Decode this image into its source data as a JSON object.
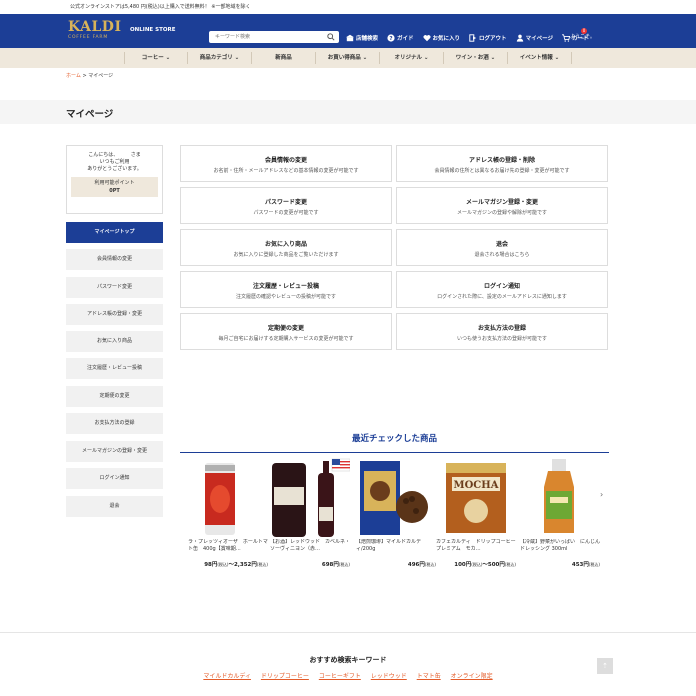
{
  "topbar": {
    "notice": "公式オンラインストアは5,480 円(税込)以上購入で送料無料！ ※一部地域を除く"
  },
  "header": {
    "logo_main": "KALDI",
    "logo_sub": "COFFEE FARM",
    "store_label": "ONLINE STORE",
    "search_placeholder": "キーワード検索",
    "welcome": "ようこそ。",
    "nav": [
      {
        "label": "店舗検索",
        "icon": "store-icon"
      },
      {
        "label": "ガイド",
        "icon": "help-icon"
      },
      {
        "label": "お気に入り",
        "icon": "heart-icon"
      },
      {
        "label": "ログアウト",
        "icon": "logout-icon"
      },
      {
        "label": "マイページ",
        "icon": "user-icon"
      },
      {
        "label": "カート",
        "icon": "cart-icon"
      }
    ],
    "cart_count": "0"
  },
  "catnav": [
    "コーヒー",
    "商品カテゴリ",
    "新商品",
    "お買い得商品",
    "オリジナル",
    "ワイン・お酒",
    "イベント情報"
  ],
  "breadcrumb": {
    "home": "ホーム",
    "sep": ">",
    "current": "マイページ"
  },
  "page_title": "マイページ",
  "greeting": {
    "line1": "こんにちは、　　　さま",
    "line2": "いつもご利用",
    "line3": "ありがとうございます。",
    "points_label": "利用可能ポイント",
    "points_value": "0PT"
  },
  "sidebar": [
    "マイページトップ",
    "会員情報の変更",
    "パスワード変更",
    "アドレス帳の登録・変更",
    "お気に入り商品",
    "注文履歴・レビュー投稿",
    "定期便の変更",
    "お支払方法の登録",
    "メールマガジンの登録・変更",
    "ログイン通知",
    "退会"
  ],
  "cards": [
    {
      "title": "会員情報の変更",
      "desc": "お名前・住所・メールアドレスなどの基本情報の変更が可能です"
    },
    {
      "title": "アドレス帳の登録・削除",
      "desc": "会員情報の住所とは異なるお届け先の登録・変更が可能です"
    },
    {
      "title": "パスワード変更",
      "desc": "パスワードの変更が可能です"
    },
    {
      "title": "メールマガジン登録・変更",
      "desc": "メールマガジンの登録や解除が可能です"
    },
    {
      "title": "お気に入り商品",
      "desc": "お気に入りに登録した商品をご覧いただけます"
    },
    {
      "title": "退会",
      "desc": "退会される場合はこちら"
    },
    {
      "title": "注文履歴・レビュー投稿",
      "desc": "注文履歴の確認やレビューの投稿が可能です"
    },
    {
      "title": "ログイン通知",
      "desc": "ログインされた際に、設定のメールアドレスに通知します"
    },
    {
      "title": "定期便の変更",
      "desc": "毎月ご自宅にお届けする定期購入サービスの変更が可能です"
    },
    {
      "title": "お支払方法の登録",
      "desc": "いつも使うお支払方法の登録が可能です"
    }
  ],
  "recent": {
    "title": "最近チェックした商品",
    "items": [
      {
        "name": "ラ・プレッツィオーザ　ホールトマト缶　400g【賞味期…",
        "price": "98円",
        "price_suffix": "(税込)",
        "price2": "～2,352円",
        "price2_suffix": "(税込)"
      },
      {
        "name": "【お酒】レッドウッド　カベルネ・ソーヴィニヨン（赤…",
        "price": "698円",
        "price_suffix": "(税込)",
        "price2": "",
        "price2_suffix": ""
      },
      {
        "name": "【焙煎珈琲】マイルドカルディ/200g",
        "price": "496円",
        "price_suffix": "(税込)",
        "price2": "",
        "price2_suffix": ""
      },
      {
        "name": "カフェカルディ　ドリップコーヒー　プレミアム　モカ…",
        "price": "100円",
        "price_suffix": "(税込)",
        "price2": "～500円",
        "price2_suffix": "(税込)"
      },
      {
        "name": "【冷蔵】野菜がいっぱい　にんじんドレッシング 300ml",
        "price": "453円",
        "price_suffix": "(税込)",
        "price2": "",
        "price2_suffix": ""
      }
    ]
  },
  "footer": {
    "kw_title": "おすすめ検索キーワード",
    "keywords": [
      "マイルドカルディ",
      "ドリップコーヒー",
      "コーヒーギフト",
      "レッドウッド",
      "トマト缶",
      "オンライン限定"
    ]
  }
}
